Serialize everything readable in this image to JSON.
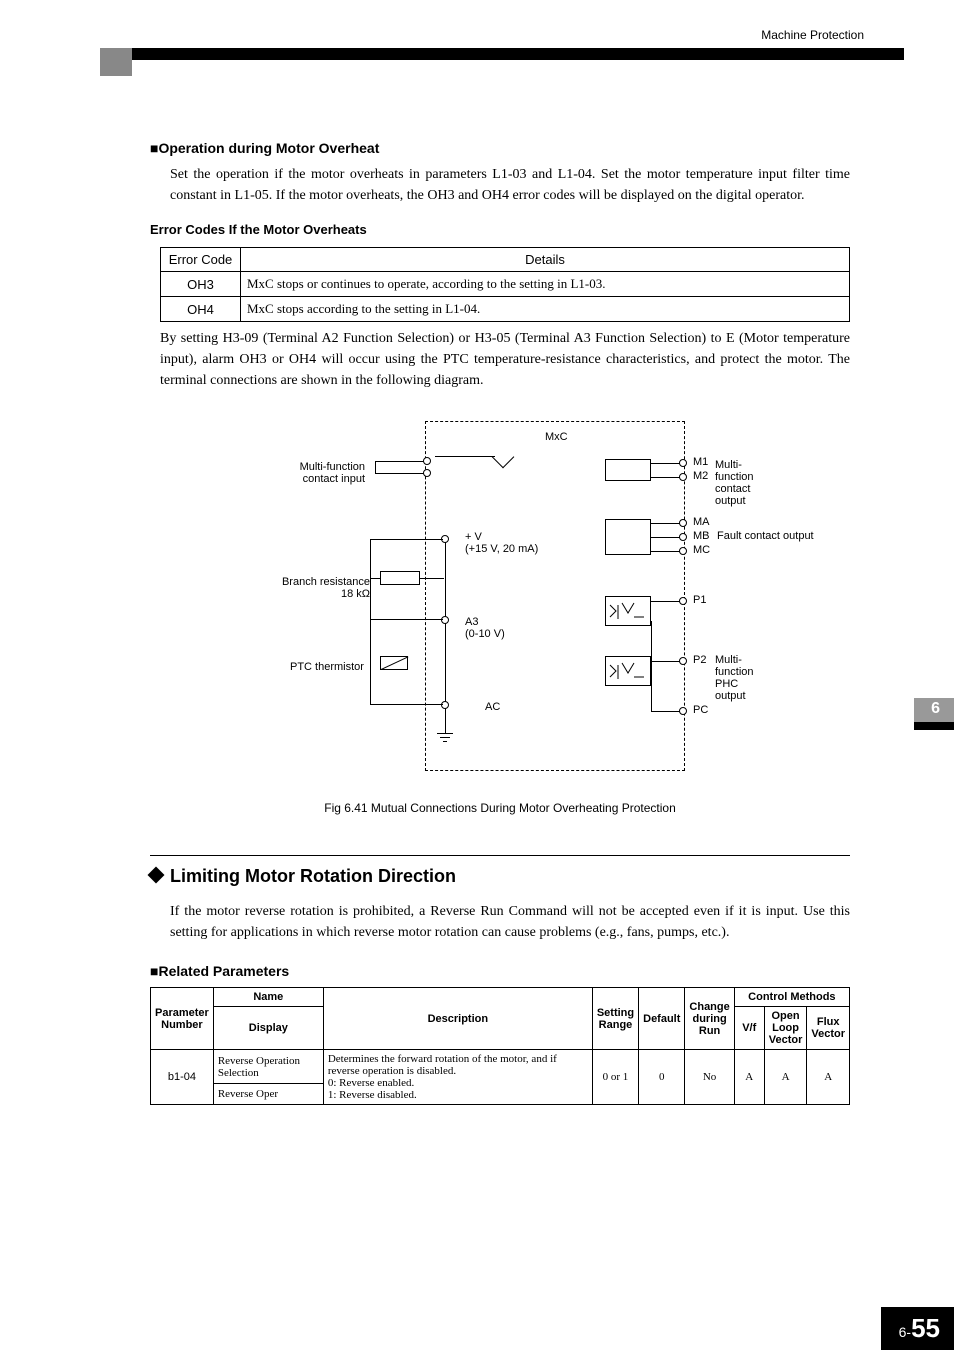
{
  "header": {
    "right": "Machine Protection"
  },
  "sec1": {
    "heading": "■Operation during Motor Overheat",
    "para": "Set the operation if the motor overheats in parameters L1-03 and L1-04. Set the motor temperature input filter time constant in L1-05. If the motor overheats, the OH3 and OH4 error codes will be displayed on the digital operator.",
    "subheading": "Error Codes If the Motor Overheats",
    "table": {
      "h1": "Error Code",
      "h2": "Details",
      "r1c1": "OH3",
      "r1c2": "MxC stops or continues to operate, according to the setting in L1-03.",
      "r2c1": "OH4",
      "r2c2": "MxC stops according to the setting in L1-04."
    },
    "para2": "By setting H3-09 (Terminal A2 Function Selection) or H3-05 (Terminal A3 Function Selection) to E (Motor temperature input), alarm OH3 or OH4 will occur using the PTC temperature-resistance characteristics, and protect the motor. The terminal connections are shown in the following diagram."
  },
  "diagram": {
    "title": "MxC",
    "l_mfci": "Multi-function\ncontact input",
    "l_branch": "Branch resistance\n18 kΩ",
    "l_ptc": "PTC thermistor",
    "l_vplus": "+ V\n(+15 V, 20 mA)",
    "l_a3": "A3\n(0-10 V)",
    "l_ac": "AC",
    "r_m1": "M1",
    "r_m2": "M2",
    "r_mfco": "Multi-function\ncontact output",
    "r_ma": "MA",
    "r_mb": "MB",
    "r_mc": "MC",
    "r_fault": "Fault contact output",
    "r_p1": "P1",
    "r_p2": "P2",
    "r_pc": "PC",
    "r_mfphc": "Multi-function\nPHC output",
    "caption": "Fig 6.41  Mutual Connections During Motor Overheating Protection"
  },
  "sec2": {
    "heading": "Limiting Motor Rotation Direction",
    "para": "If the motor reverse rotation is prohibited, a Reverse Run Command will not be accepted even if it is input. Use this setting for applications in which reverse motor rotation can cause problems (e.g., fans, pumps, etc.).",
    "subheading": "■Related Parameters",
    "table": {
      "h_param": "Parameter Number",
      "h_name": "Name",
      "h_display": "Display",
      "h_desc": "Description",
      "h_range": "Setting Range",
      "h_default": "Default",
      "h_change": "Change during Run",
      "h_methods": "Control Methods",
      "h_vf": "V/f",
      "h_olv": "Open Loop Vector",
      "h_flux": "Flux Vector",
      "r_param": "b1-04",
      "r_name": "Reverse Operation Selection",
      "r_display": "Reverse Oper",
      "r_desc": "Determines the forward rotation of the motor, and if reverse operation is disabled.\n0:  Reverse enabled.\n1:  Reverse disabled.",
      "r_range": "0 or 1",
      "r_default": "0",
      "r_change": "No",
      "r_vf": "A",
      "r_olv": "A",
      "r_flux": "A"
    }
  },
  "sidetab": "6",
  "pagenum_prefix": "6-",
  "pagenum": "55"
}
